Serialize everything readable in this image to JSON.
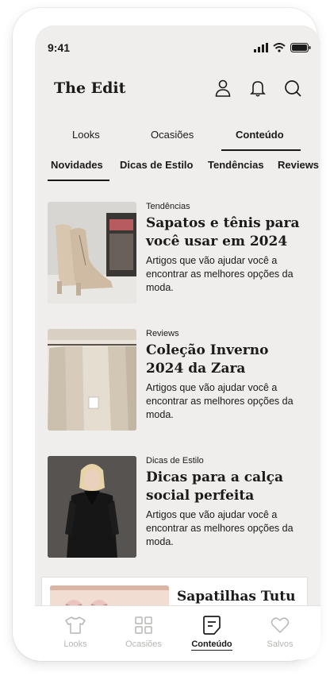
{
  "status": {
    "time": "9:41"
  },
  "header": {
    "title": "The Edit",
    "icons": [
      "user-icon",
      "bell-icon",
      "search-icon"
    ]
  },
  "tabs": [
    {
      "label": "Looks"
    },
    {
      "label": "Ocasiões"
    },
    {
      "label": "Conteúdo",
      "active": true
    }
  ],
  "subtabs": [
    {
      "label": "Novidades",
      "active": true
    },
    {
      "label": "Dicas de Estilo"
    },
    {
      "label": "Tendências"
    },
    {
      "label": "Reviews"
    }
  ],
  "articles": [
    {
      "category": "Tendências",
      "title": "Sapatos e tênis para você usar em 2024",
      "description": "Artigos que vão ajudar você a encontrar as melhores opções da moda."
    },
    {
      "category": "Reviews",
      "title": "Coleção Inverno 2024 da Zara",
      "description": "Artigos que vão ajudar você a encontrar as melhores opções da moda."
    },
    {
      "category": "Dicas de Estilo",
      "title": "Dicas para a calça social perfeita",
      "description": "Artigos que vão ajudar você a encontrar as melhores opções da moda."
    }
  ],
  "partial_card": {
    "title": "Sapatilhas Tutu"
  },
  "bottom_nav": [
    {
      "label": "Looks",
      "icon": "tshirt-icon"
    },
    {
      "label": "Ocasiões",
      "icon": "grid-icon"
    },
    {
      "label": "Conteúdo",
      "icon": "article-icon",
      "active": true
    },
    {
      "label": "Salvos",
      "icon": "heart-icon"
    }
  ],
  "colors": {
    "background": "#f0eeec",
    "text": "#1a1a1a",
    "inactive_nav": "#b8b6b3"
  }
}
